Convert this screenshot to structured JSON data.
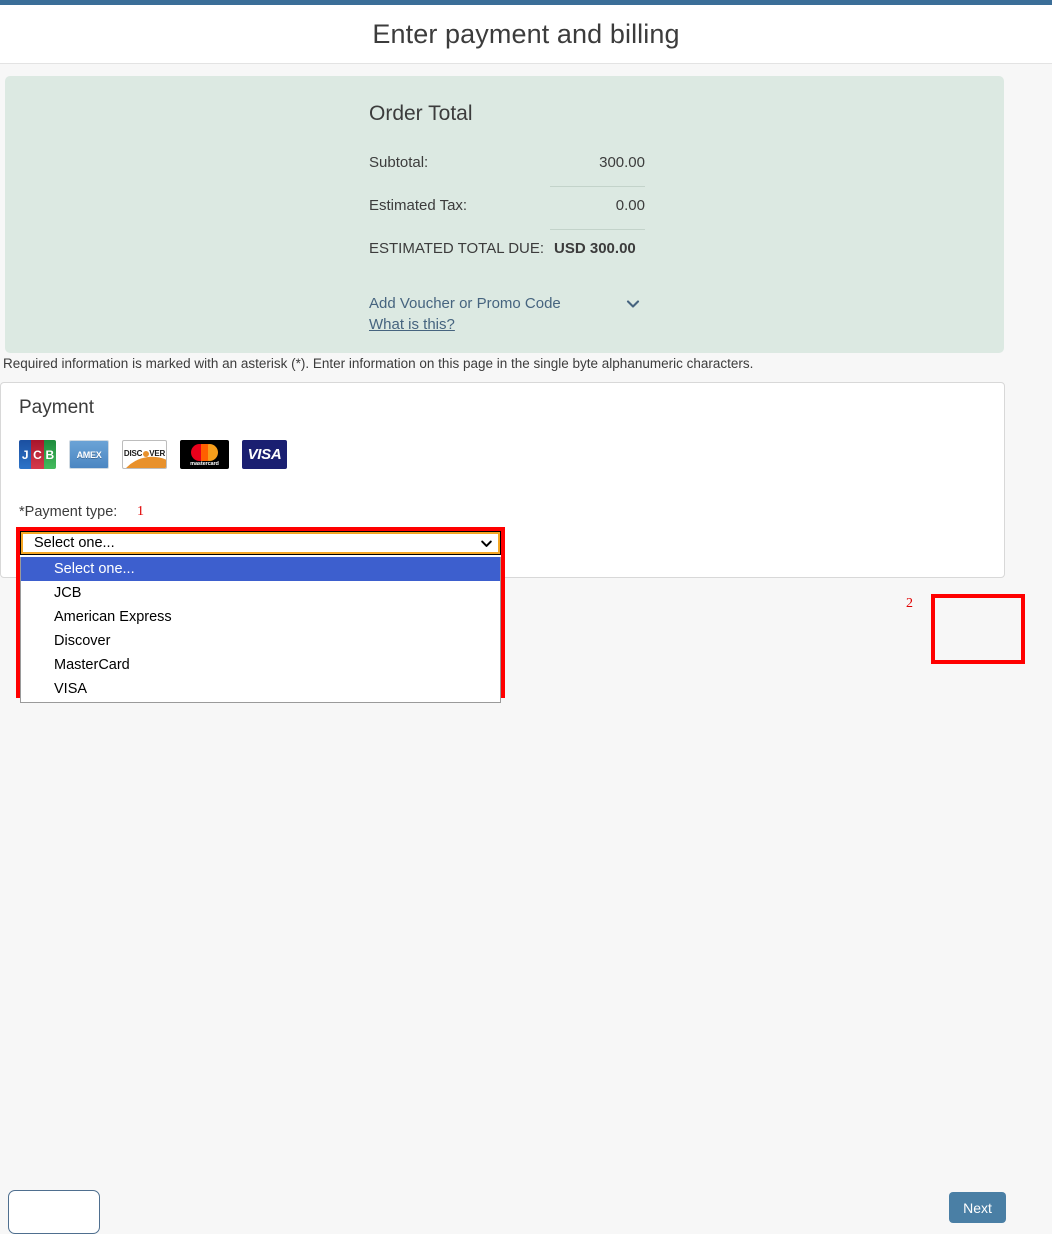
{
  "header": {
    "title": "Enter payment and billing"
  },
  "order": {
    "heading": "Order Total",
    "rows": [
      {
        "label": "Subtotal:",
        "value": "300.00"
      },
      {
        "label": "Estimated Tax:",
        "value": "0.00"
      }
    ],
    "total": {
      "label": "ESTIMATED TOTAL DUE:",
      "value": "USD 300.00"
    },
    "voucher_link": "Add Voucher or Promo Code",
    "voucher_help": "What is this?",
    "chevron_icon": "chevron-down-icon"
  },
  "required_note": "Required information is marked with an asterisk (*). Enter information on this page in the single byte alphanumeric characters.",
  "payment": {
    "heading": "Payment",
    "accepted_cards": [
      {
        "name": "jcb-card-logo",
        "text": "JCB"
      },
      {
        "name": "amex-card-logo",
        "text": "AMEX"
      },
      {
        "name": "discover-card-logo",
        "text": "DISC VER"
      },
      {
        "name": "mastercard-card-logo",
        "text": "mastercard"
      },
      {
        "name": "visa-card-logo",
        "text": "VISA"
      }
    ],
    "type_label": "*Payment type:",
    "select": {
      "value": "Select one...",
      "options": [
        "Select one...",
        "JCB",
        "American Express",
        "Discover",
        "MasterCard",
        "VISA"
      ],
      "selected_index": 0
    }
  },
  "annotations": {
    "marker_one": "1",
    "marker_two": "2"
  },
  "nav": {
    "next_label": "Next"
  },
  "colors": {
    "top_accent": "#3b6e98",
    "order_panel": "#dce9e2",
    "link": "#46647f",
    "highlight": "#ff0000",
    "dropdown_selected": "#3d5fce",
    "next_button": "#4a7fa5"
  }
}
